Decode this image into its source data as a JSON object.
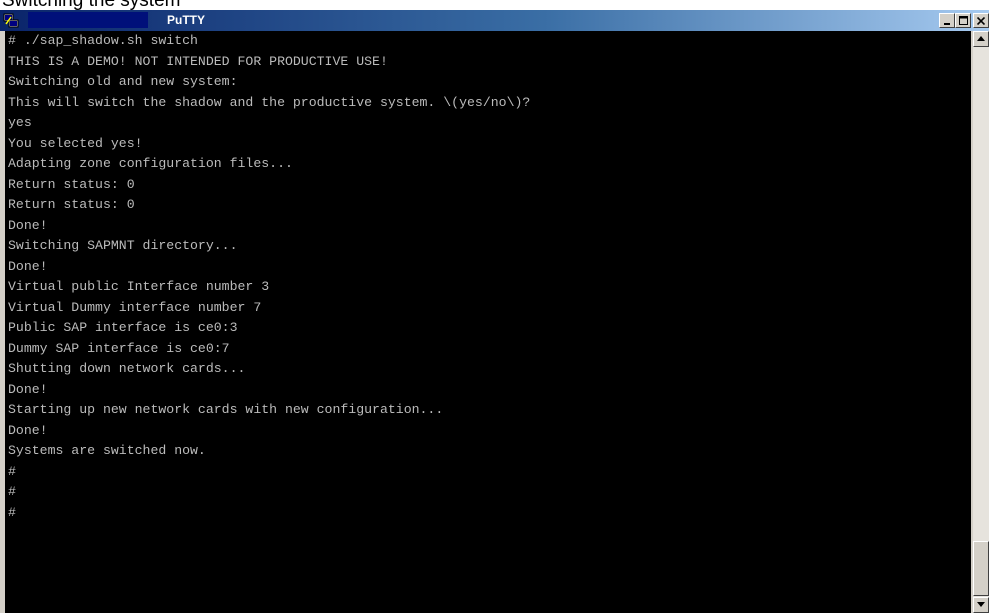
{
  "caption": "Switching the system",
  "window": {
    "title": "PuTTY",
    "buttons": {
      "minimize": "_",
      "maximize": "□",
      "close": "×"
    }
  },
  "terminal": {
    "lines": [
      "# ./sap_shadow.sh switch",
      "THIS IS A DEMO! NOT INTENDED FOR PRODUCTIVE USE!",
      "Switching old and new system:",
      "This will switch the shadow and the productive system. \\(yes/no\\)?",
      "yes",
      "You selected yes!",
      "Adapting zone configuration files...",
      "Return status: 0",
      "Return status: 0",
      "Done!",
      "Switching SAPMNT directory...",
      "Done!",
      "Virtual public Interface number 3",
      "Virtual Dummy interface number 7",
      "Public SAP interface is ce0:3",
      "Dummy SAP interface is ce0:7",
      "Shutting down network cards...",
      "Done!",
      "Starting up new network cards with new configuration...",
      "Done!",
      "Systems are switched now.",
      "#",
      "#",
      "#"
    ],
    "text_color": "#bbbbbb",
    "background": "#000000"
  },
  "icons": {
    "app": "putty-icon",
    "scroll_up": "arrow-up-icon",
    "scroll_down": "arrow-down-icon"
  }
}
